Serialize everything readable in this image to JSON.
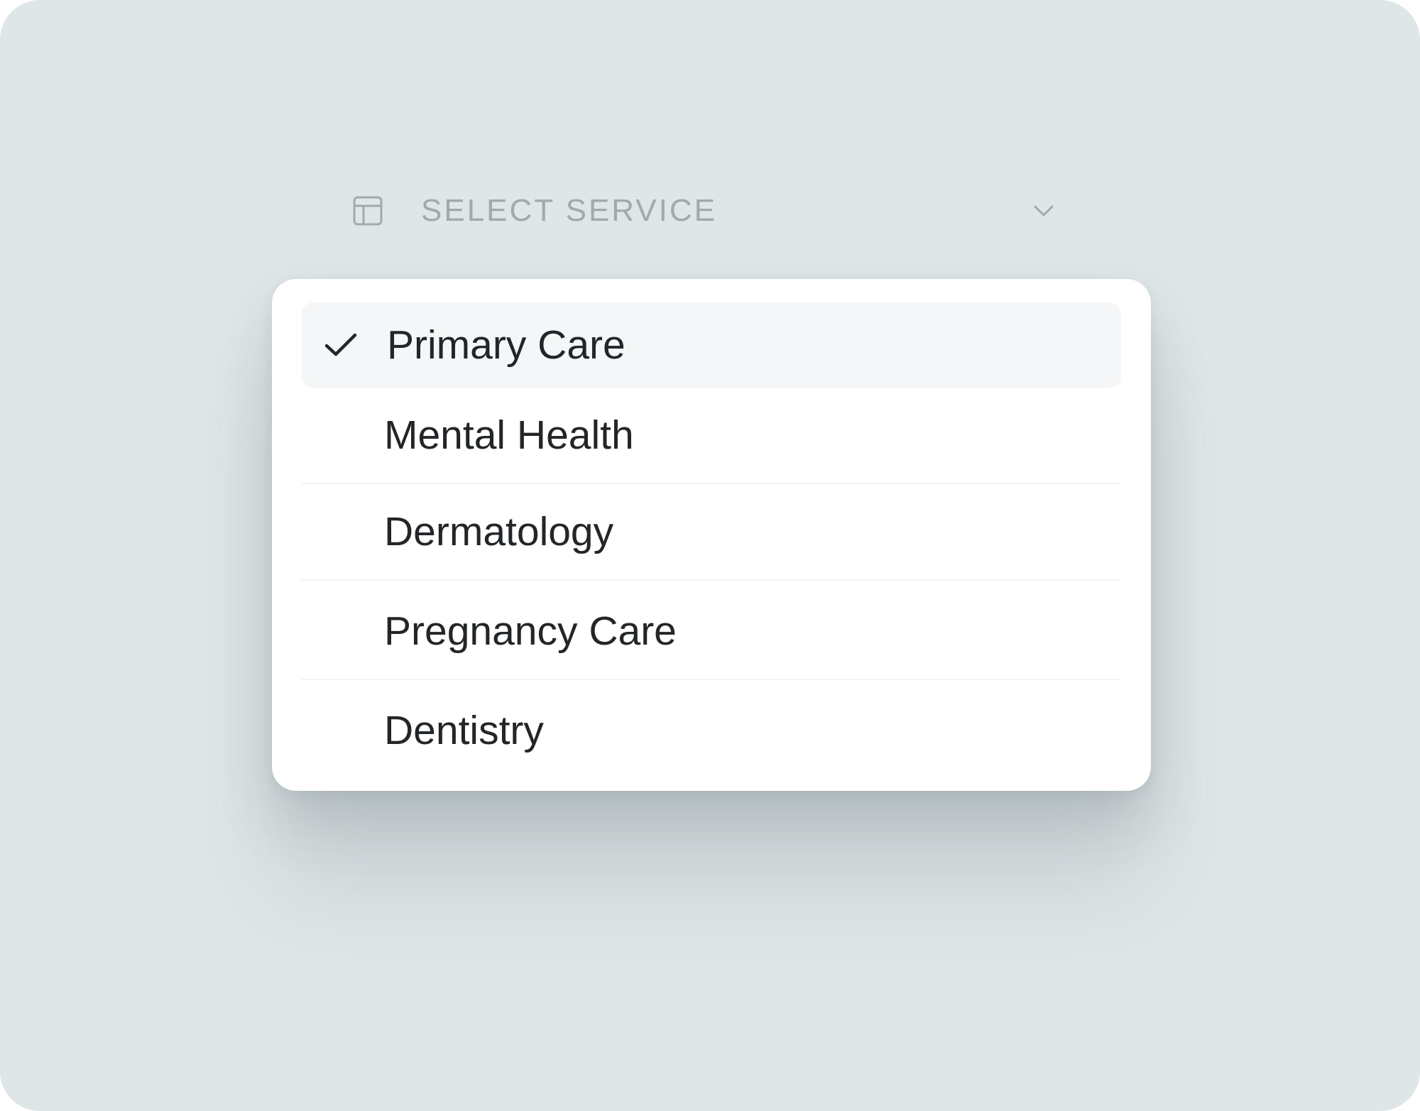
{
  "select": {
    "placeholder": "SELECT SERVICE",
    "icon": "table-icon",
    "chevron_icon": "chevron-down-icon",
    "selected_value": "Primary Care"
  },
  "options": [
    {
      "label": "Primary Care",
      "selected": true
    },
    {
      "label": "Mental Health",
      "selected": false
    },
    {
      "label": "Dermatology",
      "selected": false
    },
    {
      "label": "Pregnancy Care",
      "selected": false
    },
    {
      "label": "Dentistry",
      "selected": false
    }
  ],
  "colors": {
    "background": "#dfe6e8",
    "menu": "#ffffff",
    "selected_row": "#f4f6f7",
    "text": "#232628",
    "placeholder_text": "#a3a9ab"
  }
}
